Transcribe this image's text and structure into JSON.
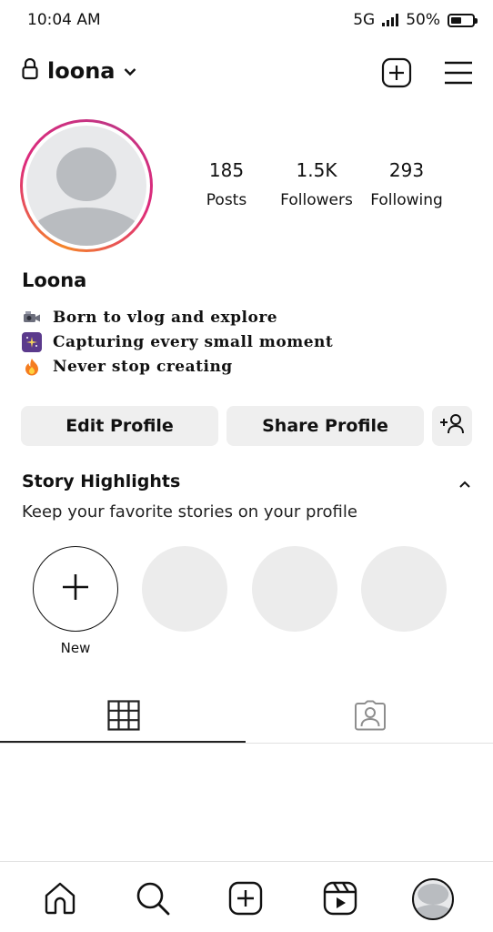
{
  "status_bar": {
    "time": "10:04 AM",
    "network": "5G",
    "battery": "50%",
    "battery_level": 0.5
  },
  "header": {
    "username": "loona",
    "icons": [
      "lock-icon",
      "chevron-down-icon",
      "create-post-icon",
      "menu-icon"
    ]
  },
  "profile": {
    "display_name": "Loona",
    "stats": [
      {
        "value": "185",
        "label": "Posts"
      },
      {
        "value": "1.5K",
        "label": "Followers"
      },
      {
        "value": "293",
        "label": "Following"
      }
    ],
    "bio": [
      {
        "icon": "camera-emoji",
        "text": "Born to vlog and explore"
      },
      {
        "icon": "sparkle-photo-emoji",
        "text": "Capturing every small moment"
      },
      {
        "icon": "fire-emoji",
        "text": "Never stop creating"
      }
    ]
  },
  "actions": {
    "edit_profile": "Edit Profile",
    "share_profile": "Share Profile"
  },
  "highlights": {
    "title": "Story Highlights",
    "subtitle": "Keep your favorite stories on your profile",
    "new_label": "New"
  },
  "tabs": [
    "grid-icon",
    "tagged-icon"
  ],
  "bottom_nav": [
    "home-icon",
    "search-icon",
    "create-icon",
    "reels-icon",
    "profile-avatar"
  ],
  "colors": {
    "story_ring_start": "#f58529",
    "story_ring_end": "#c13584",
    "button_bg": "#efefef"
  }
}
